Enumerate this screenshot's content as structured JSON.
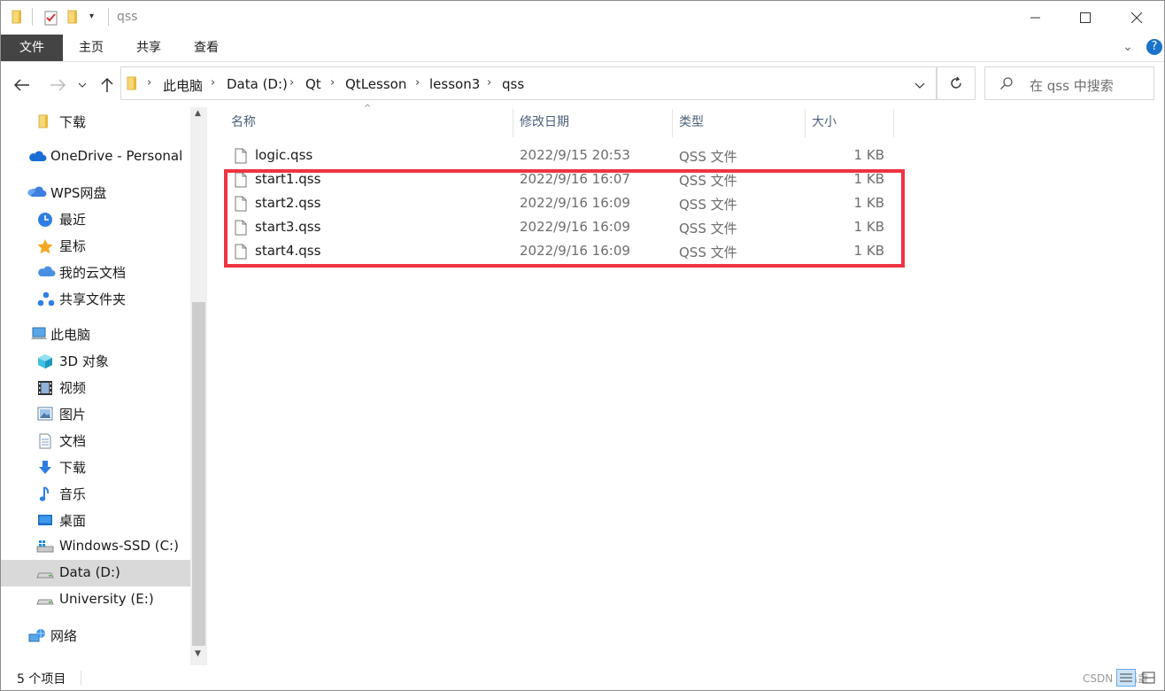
{
  "window": {
    "title": "qss"
  },
  "ribbon": {
    "tabs": [
      "文件",
      "主页",
      "共享",
      "查看"
    ]
  },
  "address": {
    "breadcrumbs": [
      "此电脑",
      "Data (D:)",
      "Qt",
      "QtLesson",
      "lesson3",
      "qss"
    ]
  },
  "search": {
    "placeholder": "在 qss 中搜索"
  },
  "sidebar": {
    "items": [
      {
        "label": "下载",
        "icon": "folder-icon"
      },
      {
        "label": "OneDrive - Personal",
        "icon": "onedrive-cloud-icon"
      },
      {
        "label": "WPS网盘",
        "icon": "wps-cloud-icon"
      },
      {
        "label": "最近",
        "icon": "clock-icon"
      },
      {
        "label": "星标",
        "icon": "star-icon"
      },
      {
        "label": "我的云文档",
        "icon": "cloud-doc-icon"
      },
      {
        "label": "共享文件夹",
        "icon": "share-folder-icon"
      },
      {
        "label": "此电脑",
        "icon": "computer-icon"
      },
      {
        "label": "3D 对象",
        "icon": "cube-3d-icon"
      },
      {
        "label": "视频",
        "icon": "film-icon"
      },
      {
        "label": "图片",
        "icon": "picture-icon"
      },
      {
        "label": "文档",
        "icon": "document-icon"
      },
      {
        "label": "下载",
        "icon": "download-arrow-icon"
      },
      {
        "label": "音乐",
        "icon": "music-note-icon"
      },
      {
        "label": "桌面",
        "icon": "desktop-icon"
      },
      {
        "label": "Windows-SSD (C:)",
        "icon": "windows-drive-icon"
      },
      {
        "label": "Data (D:)",
        "icon": "drive-icon"
      },
      {
        "label": "University (E:)",
        "icon": "drive-icon"
      },
      {
        "label": "网络",
        "icon": "network-icon"
      }
    ]
  },
  "columns": {
    "name": "名称",
    "modified": "修改日期",
    "type": "类型",
    "size": "大小"
  },
  "files": [
    {
      "name": "logic.qss",
      "modified": "2022/9/15 20:53",
      "type": "QSS 文件",
      "size": "1 KB"
    },
    {
      "name": "start1.qss",
      "modified": "2022/9/16 16:07",
      "type": "QSS 文件",
      "size": "1 KB"
    },
    {
      "name": "start2.qss",
      "modified": "2022/9/16 16:09",
      "type": "QSS 文件",
      "size": "1 KB"
    },
    {
      "name": "start3.qss",
      "modified": "2022/9/16 16:09",
      "type": "QSS 文件",
      "size": "1 KB"
    },
    {
      "name": "start4.qss",
      "modified": "2022/9/16 16:09",
      "type": "QSS 文件",
      "size": "1 KB"
    }
  ],
  "status": {
    "count": "5 个项目"
  },
  "watermark": "CSDN @孤盏",
  "colors": {
    "highlight": "#ee3441",
    "file_tab": "#444444",
    "selected": "#d9d9d9"
  }
}
